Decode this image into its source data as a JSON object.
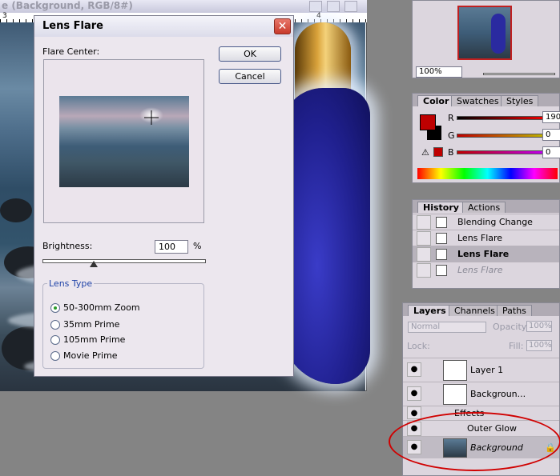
{
  "document": {
    "title": "e (Background, RGB/8#)",
    "ruler_marks": [
      "3",
      "4"
    ]
  },
  "dialog": {
    "title": "Lens Flare",
    "close_glyph": "✕",
    "flare_center_label": "Flare Center:",
    "ok_label": "OK",
    "cancel_label": "Cancel",
    "brightness_label": "Brightness:",
    "brightness_value": "100",
    "percent": "%",
    "brightness_level": 100,
    "lens_type_label": "Lens Type",
    "lens_types": [
      "50-300mm Zoom",
      "35mm Prime",
      "105mm Prime",
      "Movie Prime"
    ],
    "selected_lens": "50-300mm Zoom"
  },
  "navigator": {
    "zoom": "100%"
  },
  "color_panel": {
    "tabs": [
      "Color",
      "Swatches",
      "Styles"
    ],
    "channels": [
      {
        "name": "R",
        "value": "190"
      },
      {
        "name": "G",
        "value": "0"
      },
      {
        "name": "B",
        "value": "0"
      }
    ],
    "foreground_color": "#be0000",
    "background_color": "#000000"
  },
  "history_panel": {
    "tabs": [
      "History",
      "Actions"
    ],
    "items": [
      "Blending Change",
      "Lens Flare",
      "Lens Flare",
      "Lens Flare"
    ],
    "current_index": 2
  },
  "layers_panel": {
    "tabs": [
      "Layers",
      "Channels",
      "Paths"
    ],
    "blend_mode": "Normal",
    "opacity_label": "Opacity:",
    "opacity_value": "100%",
    "lock_label": "Lock:",
    "fill_label": "Fill:",
    "fill_value": "100%",
    "layers": [
      {
        "name": "Layer 1"
      },
      {
        "name": "Backgroun..."
      },
      {
        "name": "Effects"
      },
      {
        "name": "Outer Glow"
      },
      {
        "name": "Background"
      }
    ],
    "highlight_color": "#d00000"
  }
}
